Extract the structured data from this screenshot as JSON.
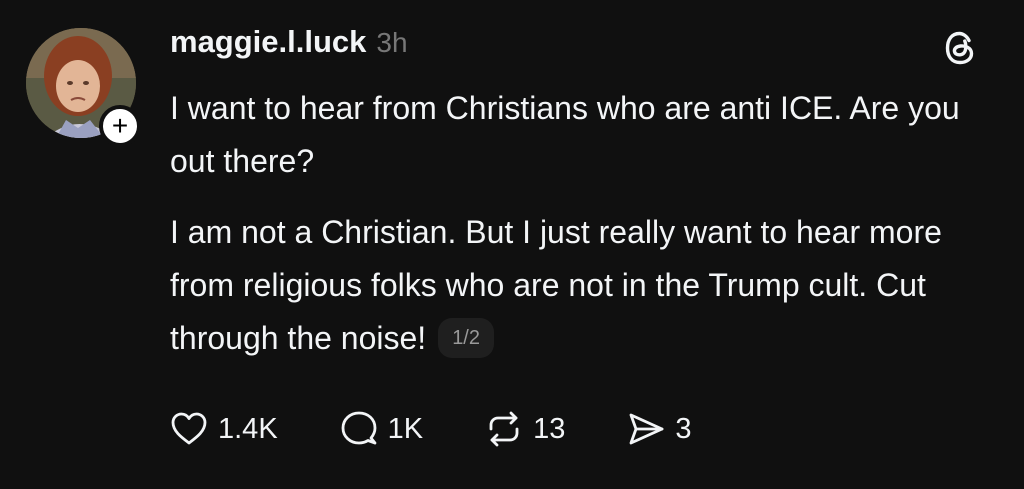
{
  "post": {
    "username": "maggie.l.luck",
    "timestamp": "3h",
    "follow_badge": "+",
    "paragraphs": [
      "I want to hear from Christians who are anti ICE. Are you out there?",
      "I am not a Christian. But I just really want to hear more from religious folks who are not in the Trump cult. Cut through the noise!"
    ],
    "page_indicator": "1/2"
  },
  "actions": {
    "likes": "1.4K",
    "replies": "1K",
    "reposts": "13",
    "shares": "3"
  },
  "icons": {
    "brand": "threads-logo-icon",
    "like": "heart-icon",
    "reply": "speech-bubble-icon",
    "repost": "repost-icon",
    "share": "send-icon"
  },
  "colors": {
    "background": "#101010",
    "text": "#f3f5f7",
    "secondary_text": "#777777",
    "badge_background": "#ffffff"
  }
}
